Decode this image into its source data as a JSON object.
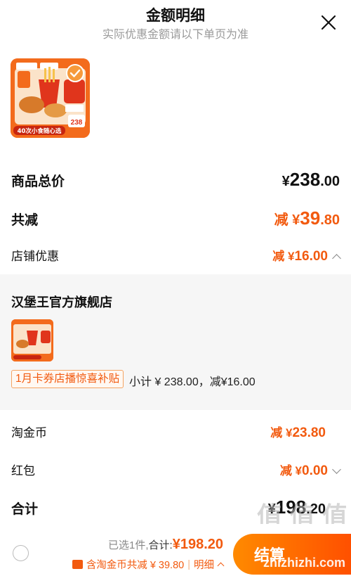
{
  "header": {
    "title": "金额明细",
    "subtitle": "实际优惠金额请以下单页为准",
    "close_icon": "close-icon"
  },
  "product": {
    "image_icon": "product-image",
    "badge_text": "40次小食随心选",
    "selected": true
  },
  "summary": {
    "total_label": "商品总价",
    "total_currency": "¥",
    "total_int": "238",
    "total_dec": ".00",
    "reduce_label": "共减",
    "reduce_prefix": "减 ¥",
    "reduce_int": "39",
    "reduce_dec": ".80",
    "store_discount_label": "店铺优惠",
    "store_discount_prefix": "减 ¥",
    "store_discount_int": "16",
    "store_discount_dec": ".00"
  },
  "store": {
    "name": "汉堡王官方旗舰店",
    "promo_tag": "1月卡券店播惊喜补贴",
    "subtotal_text": "小计 ¥ 238.00，减¥16.00"
  },
  "extras": {
    "coin_label": "淘金币",
    "coin_prefix": "减 ¥",
    "coin_int": "23",
    "coin_dec": ".80",
    "redpacket_label": "红包",
    "redpacket_prefix": "减 ¥",
    "redpacket_int": "0",
    "redpacket_dec": ".00",
    "sum_label": "合计",
    "sum_currency": "¥",
    "sum_int": "198",
    "sum_dec": ".20"
  },
  "bottom_bar": {
    "selected_text": "已选1件,",
    "total_label": "合计:",
    "total_value": "¥198.20",
    "coin_text": "含淘金币共减 ¥ 39.80",
    "sep": "|",
    "detail_label": "明细",
    "checkout_label": "结算"
  },
  "watermark": {
    "text": "值 值 值",
    "url": "zhizhizhi.com"
  },
  "colors": {
    "accent": "#f25a0f",
    "checkout_from": "#ff8a00",
    "checkout_to": "#ff5000",
    "panel_bg": "#f6f6f6"
  }
}
